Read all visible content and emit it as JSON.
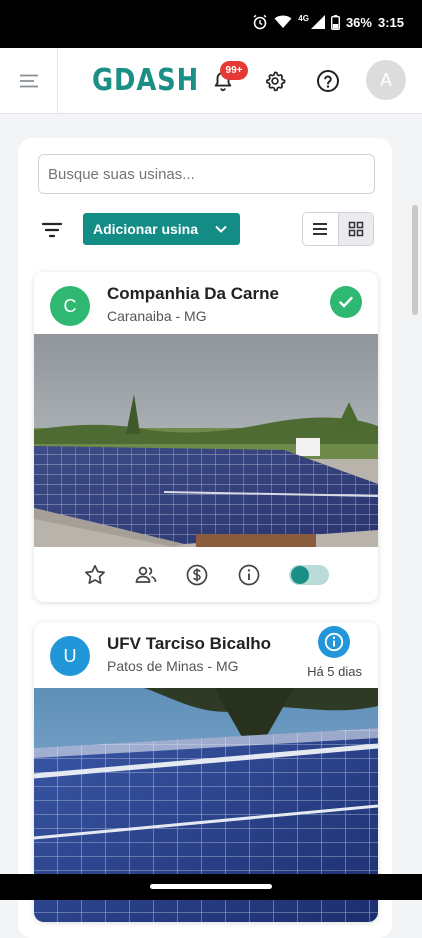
{
  "status_bar": {
    "battery": "36%",
    "time": "3:15",
    "network": "4G",
    "icons": [
      "alarm-icon",
      "wifi-icon",
      "signal-icon",
      "battery-icon"
    ]
  },
  "header": {
    "logo": "GDASH",
    "notification_count": "99+",
    "avatar_initial": "A",
    "icons": [
      "menu-icon",
      "bell-icon",
      "gear-icon",
      "help-icon"
    ]
  },
  "toolbar": {
    "search_placeholder": "Busque suas usinas...",
    "add_plant_label": "Adicionar usina"
  },
  "plants": [
    {
      "initial": "C",
      "name": "Companhia Da Carne",
      "location": "Caranaiba - MG",
      "status": "ok",
      "initial_color": "#2eb872",
      "active": true
    },
    {
      "initial": "U",
      "name": "UFV Tarciso Bicalho",
      "location": "Patos de Minas - MG",
      "status": "info",
      "last_update": "Há 5 dias",
      "initial_color": "#2196d8"
    }
  ],
  "colors": {
    "brand": "#1b8f86",
    "success": "#2eb872",
    "info": "#2196d8",
    "badge": "#e53935"
  }
}
